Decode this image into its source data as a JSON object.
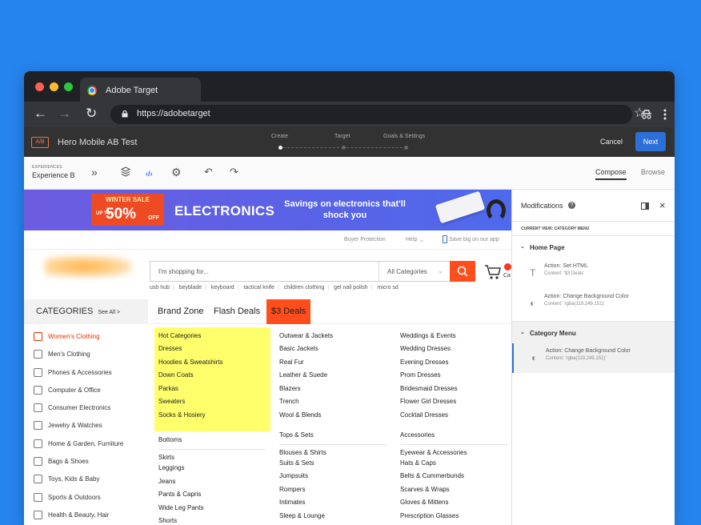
{
  "browser": {
    "tab_title": "Adobe Target",
    "url": "https://adobetarget"
  },
  "target_header": {
    "badge": "A/B",
    "activity_title": "Hero Mobile AB Test",
    "steps": [
      "Create",
      "Target",
      "Goals & Settings"
    ],
    "cancel_label": "Cancel",
    "next_label": "Next"
  },
  "toolbar": {
    "experiences_label": "EXPERIENCES",
    "experience_name": "Experience B",
    "compose_label": "Compose",
    "browse_label": "Browse"
  },
  "site": {
    "banner": {
      "winter_sale": "WINTER SALE",
      "up_to": "UP TO",
      "percent": "50%",
      "off": "OFF",
      "headline": "ELECTRONICS",
      "tagline": "Savings on electronics that'll shock you"
    },
    "utility_links": [
      "Buyer Protection",
      "Help",
      "Save big on our app"
    ],
    "search_placeholder": "I'm shopping for...",
    "search_category": "All Categories",
    "suggestions": [
      "usb hub",
      "beyblade",
      "keyboard",
      "tactical knife",
      "children clothing",
      "gel nail polish",
      "micro sd"
    ],
    "cart_label": "Ca",
    "categories_label": "CATEGORIES",
    "see_all": "See All >",
    "nav": [
      "Brand Zone",
      "Flash Deals",
      "$3 Deals"
    ],
    "side_menu": [
      "Women's Clothing",
      "Men's Clothing",
      "Phones & Accessories",
      "Computer & Office",
      "Consumer Electronics",
      "Jewelry & Watches",
      "Home & Garden, Furniture",
      "Bags & Shoes",
      "Toys, Kids & Baby",
      "Sports & Outdoors",
      "Health & Beauty, Hair"
    ],
    "columns": [
      {
        "groups": [
          {
            "header": "Hot Categories",
            "items": [
              "Dresses",
              "Hoodies & Sweatshirts",
              "Down Coats",
              "Parkas",
              "Sweaters",
              "Socks & Hosiery"
            ]
          },
          {
            "header": "Bottoms",
            "items": [
              "Skirts",
              "Leggings",
              "Jeans",
              "Pants & Capris",
              "Wide Leg Pants",
              "Shorts"
            ]
          }
        ]
      },
      {
        "groups": [
          {
            "header": "Outwear & Jackets",
            "items": [
              "Basic Jackets",
              "Real Fur",
              "Leather & Suede",
              "Blazers",
              "Trench",
              "Wool & Blends"
            ]
          },
          {
            "header": "Tops & Sets",
            "items": [
              "Blouses & Shirts",
              "Suits & Sets",
              "Jumpsuits",
              "Rompers",
              "Intimates",
              "Sleep & Lounge"
            ]
          }
        ]
      },
      {
        "groups": [
          {
            "header": "Weddings & Events",
            "items": [
              "Wedding Dresses",
              "Evening Dresses",
              "Prom Dresses",
              "Bridesmaid Dresses",
              "Flower Girl Dresses",
              "Cocktail Dresses"
            ]
          },
          {
            "header": "Accessories",
            "items": [
              "Eyewear & Accessories",
              "Hats & Caps",
              "Belts & Cummerbunds",
              "Scarves & Wraps",
              "Gloves & Mittens",
              "Prescription Glasses"
            ]
          }
        ]
      }
    ]
  },
  "panel": {
    "title": "Modifications",
    "current_view": "CURRENT VIEW: CATEGORY MENU",
    "groups": [
      {
        "name": "Home Page",
        "actions": [
          {
            "action": "Action: Set HTML",
            "content": "Content: '$3 Deals'"
          },
          {
            "action": "Action: Change Background Color",
            "content": "Content: 'rgba(119,249,151)'"
          }
        ]
      },
      {
        "name": "Category Menu",
        "actions": [
          {
            "action": "Action: Change Background Color",
            "content": "Content: 'rgba(119,249,151)'"
          }
        ]
      }
    ]
  },
  "colors": {
    "background": "#2684ef",
    "accent": "#2d6fd8",
    "site_orange": "#ff4e1b",
    "highlight": "#ffff6b"
  }
}
